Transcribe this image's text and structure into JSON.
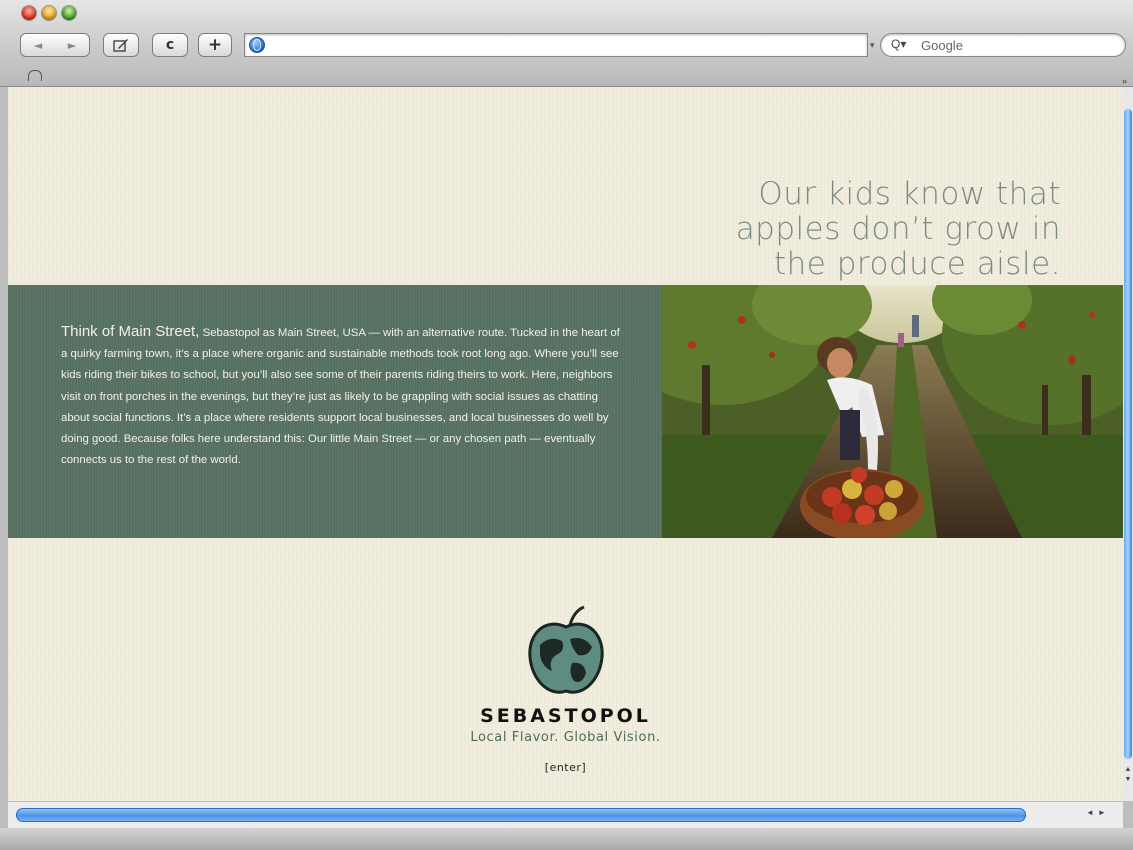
{
  "browser": {
    "back_icon": "◄",
    "forward_icon": "►",
    "reload_icon": "c",
    "add_icon": "+",
    "url": "",
    "search_placeholder": "Google",
    "search_icon": "Q▾",
    "dropdown_icon": "▾",
    "more_icon": "»"
  },
  "page": {
    "headline": [
      "Our kids know that",
      "apples don’t grow in",
      "the produce aisle."
    ],
    "lead": "Think of Main Street,",
    "body": " Sebastopol as Main Street, USA — with an alternative route. Tucked in the heart of a quirky farming town, it’s a place where organic and sustainable methods took root long ago. Where you’ll see kids riding their bikes to school, but you’ll also see some of their parents riding theirs to work. Here, neighbors  visit on front porches in the evenings, but they’re just as likely to be grappling with social issues as chatting about social functions. It’s a place where residents support local businesses, and local businesses do well by doing good. Because folks here understand this: Our little Main Street — or any chosen path — eventually connects us to the rest of the world.",
    "brand_name": "SEBASTOPOL",
    "tagline": "Local Flavor. Global Vision.",
    "enter_link": "[enter]"
  },
  "colors": {
    "band": "#567162",
    "headline": "#7c8a84",
    "tagline": "#4f6b5b",
    "background": "#efecdc"
  },
  "icons": {
    "logo": "apple-globe-icon",
    "photo": "girl-picking-apples-photo"
  }
}
